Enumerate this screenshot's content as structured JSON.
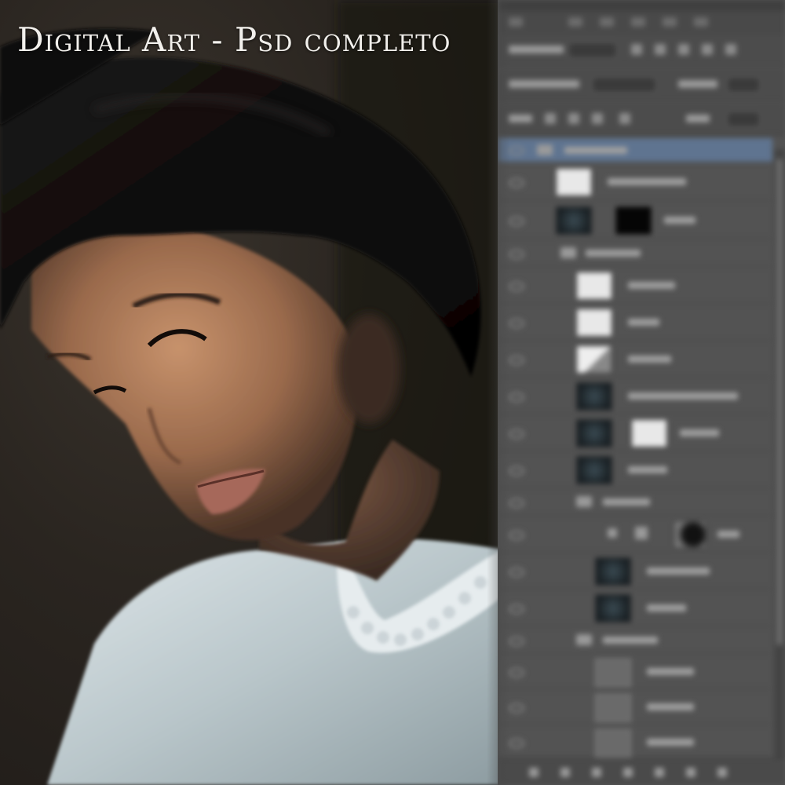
{
  "title": "Digital Art - Psd completo",
  "colors": {
    "panel_bg": "#535353",
    "selected_layer": "#5f7490",
    "title_text": "#f2f0ec"
  },
  "icons": {
    "visibility": "eye-icon",
    "group": "folder-icon"
  }
}
